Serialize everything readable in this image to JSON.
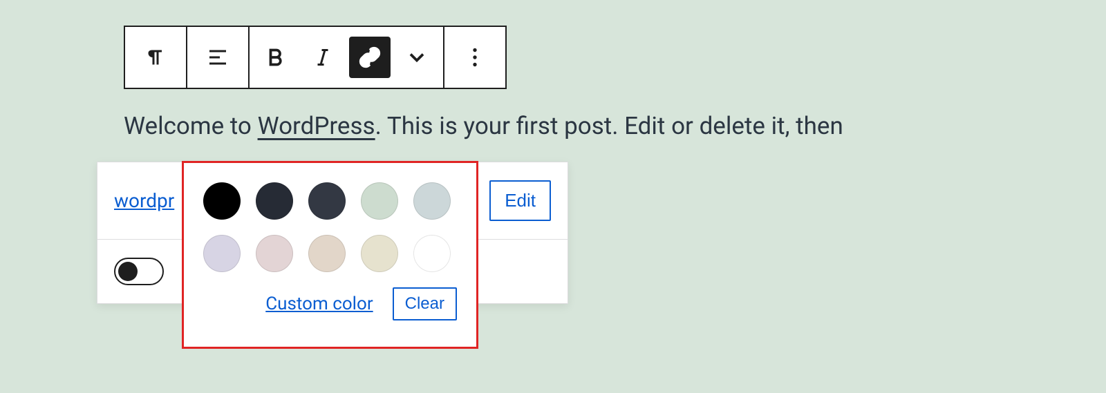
{
  "paragraph": {
    "pre": "Welcome to ",
    "link_text": "WordPress",
    "post": ". This is your first post. Edit or delete it, then"
  },
  "link_panel": {
    "url_label": "wordpr",
    "edit_label": "Edit"
  },
  "color_popover": {
    "custom_label": "Custom color",
    "clear_label": "Clear",
    "swatches": [
      "#000000",
      "#262b35",
      "#333843",
      "#cddccf",
      "#ccd7d9",
      "#d7d4e4",
      "#e3d4d5",
      "#e2d6c9",
      "#e6e2ce",
      "#ffffff"
    ]
  },
  "toolbar": {
    "icons": {
      "paragraph": "paragraph-icon",
      "align": "align-icon",
      "bold": "bold-icon",
      "italic": "italic-icon",
      "link": "link-icon",
      "chevron": "chevron-down-icon",
      "more": "more-icon"
    }
  }
}
